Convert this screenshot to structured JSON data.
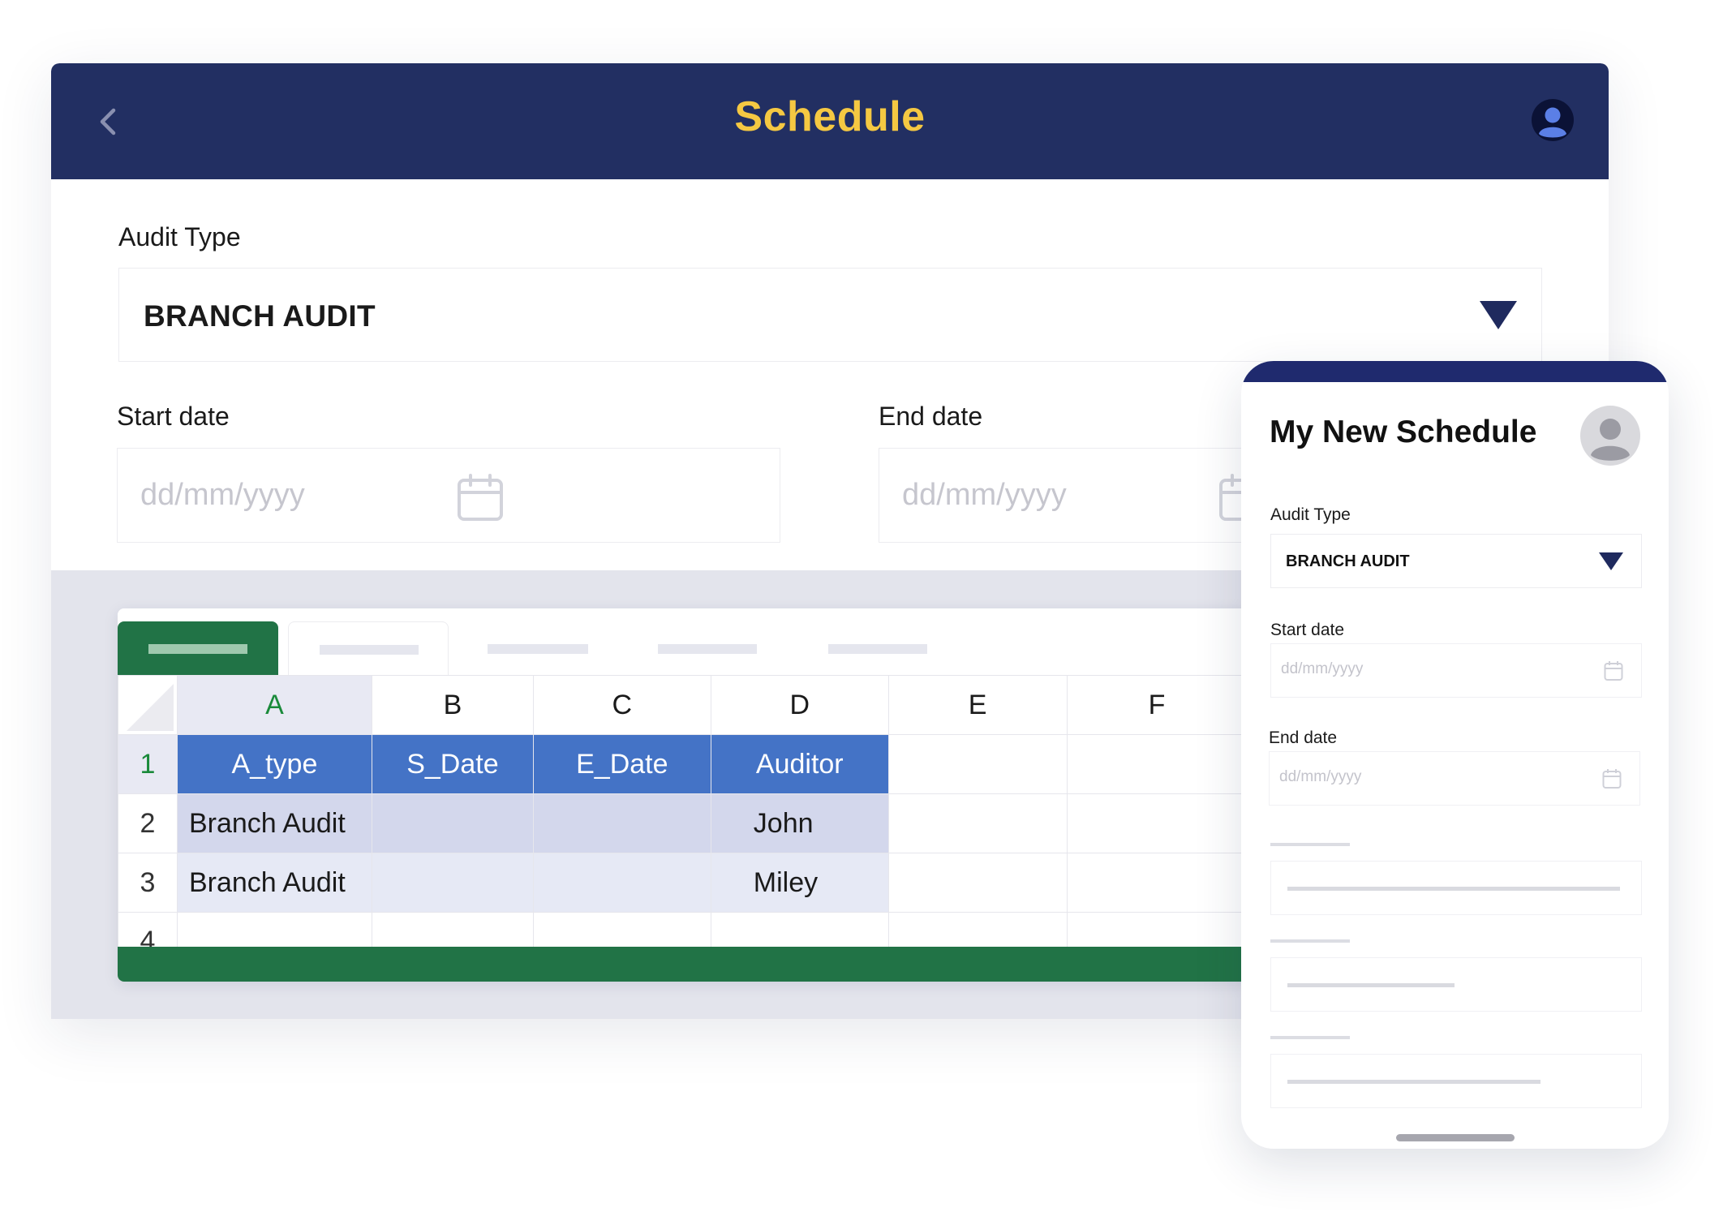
{
  "desktop": {
    "title": "Schedule",
    "audit_type": {
      "label": "Audit Type",
      "value": "BRANCH AUDIT"
    },
    "start_date": {
      "label": "Start date",
      "placeholder": "dd/mm/yyyy"
    },
    "end_date": {
      "label": "End date",
      "placeholder": "dd/mm/yyyy"
    }
  },
  "sheet": {
    "columns": [
      "A",
      "B",
      "C",
      "D",
      "E",
      "F"
    ],
    "rows": [
      {
        "num": "1",
        "cells": [
          "A_type",
          "S_Date",
          "E_Date",
          "Auditor",
          "",
          ""
        ]
      },
      {
        "num": "2",
        "cells": [
          "Branch Audit",
          "",
          "",
          "John",
          "",
          ""
        ]
      },
      {
        "num": "3",
        "cells": [
          "Branch Audit",
          "",
          "",
          "Miley",
          "",
          ""
        ]
      },
      {
        "num": "4",
        "cells": [
          "",
          "",
          "",
          "",
          "",
          ""
        ]
      }
    ]
  },
  "mobile": {
    "title": "My New Schedule",
    "audit_type": {
      "label": "Audit Type",
      "value": "BRANCH AUDIT"
    },
    "start_date": {
      "label": "Start date",
      "placeholder": "dd/mm/yyyy"
    },
    "end_date": {
      "label": "End date",
      "placeholder": "dd/mm/yyyy"
    }
  },
  "colors": {
    "header_navy": "#222f62",
    "title_yellow": "#f5c842",
    "excel_green": "#217346",
    "header_row_blue": "#4473c6"
  },
  "icons": [
    "chevron-left-icon",
    "user-avatar-icon",
    "caret-down-icon",
    "calendar-icon"
  ]
}
